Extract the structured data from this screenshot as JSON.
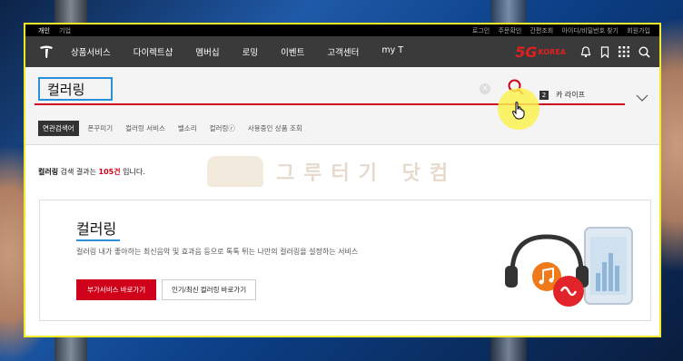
{
  "util_bar": {
    "left": [
      "개인",
      "기업"
    ],
    "right": [
      "로그인",
      "주문확인",
      "간편조회",
      "아이디/비밀번호 찾기",
      "회원가입"
    ]
  },
  "nav": {
    "items": [
      "상품서비스",
      "다이렉트샵",
      "멤버십",
      "로밍",
      "이벤트",
      "고객센터",
      "my T"
    ],
    "brand": {
      "five_g": "5G",
      "korea": "KOREA"
    }
  },
  "search": {
    "query": "컬러링",
    "clear_label": "×"
  },
  "realtime_rank": {
    "number": "2",
    "keyword": "카 라이프"
  },
  "related": {
    "tag": "연관검색어",
    "items": [
      "폰꾸미기",
      "컬러링 서비스",
      "벨소리",
      "컬러링ⓡ",
      "사용중인 상품 조회"
    ]
  },
  "results": {
    "keyword": "컬러링",
    "text1": " 검색 결과는 ",
    "count": "105건",
    "text2": " 입니다."
  },
  "watermark": {
    "text": "그루터기 닷컴"
  },
  "card": {
    "title": "컬러링",
    "description": "컬러링 내가 좋아하는 최신음악 및 효과음 등으로 톡톡 튀는 나만의 컬러링을 설정하는 서비스",
    "primary_button": "부가서비스 바로가기",
    "secondary_button": "인기/최신 컬러링 바로가기"
  },
  "colors": {
    "accent": "#d0021b",
    "highlight": "#2a8fd6",
    "frame": "#f3ea2a"
  },
  "icons": [
    "t-logo-icon",
    "bell-icon",
    "bookmark-icon",
    "grid-menu-icon",
    "search-icon",
    "chevron-down-icon",
    "pointer-cursor-icon",
    "music-note-icon",
    "ringtone-icon",
    "headphones-icon",
    "phone-icon"
  ]
}
